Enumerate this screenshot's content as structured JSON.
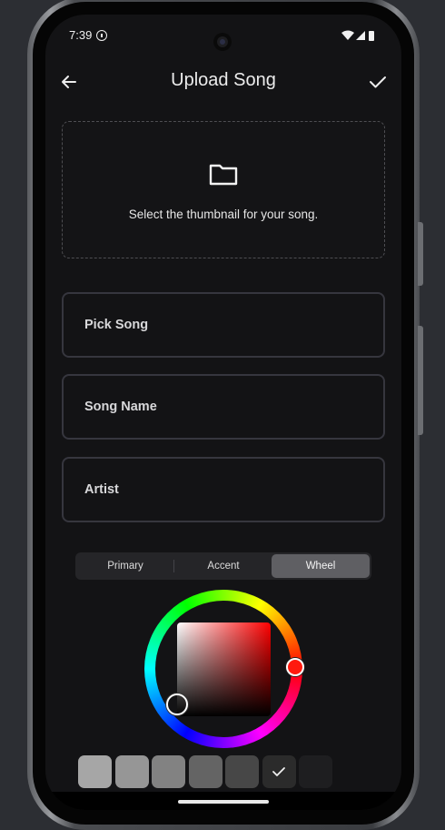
{
  "status_bar": {
    "time": "7:39",
    "icons": [
      "info-icon",
      "wifi-icon",
      "signal-icon",
      "battery-icon"
    ]
  },
  "header": {
    "title": "Upload Song",
    "back_icon": "arrow-left-icon",
    "confirm_icon": "check-icon"
  },
  "thumbnail": {
    "icon": "folder-icon",
    "text": "Select the thumbnail for your song."
  },
  "form": {
    "pick_song_placeholder": "Pick Song",
    "song_name_placeholder": "Song Name",
    "artist_placeholder": "Artist"
  },
  "color_picker": {
    "tabs": [
      "Primary",
      "Accent",
      "Wheel"
    ],
    "selected_tab": "Wheel",
    "selected_color": "#ff1a0f",
    "swatches": [
      "#a6a6a6",
      "#969696",
      "#828282",
      "#646464",
      "#474747",
      "#2b2b2b",
      "#1e1e20"
    ],
    "selected_swatch_index": 5
  },
  "colors": {
    "background": "#131315",
    "field_border": "#36363e",
    "text": "#e6e6e6"
  }
}
